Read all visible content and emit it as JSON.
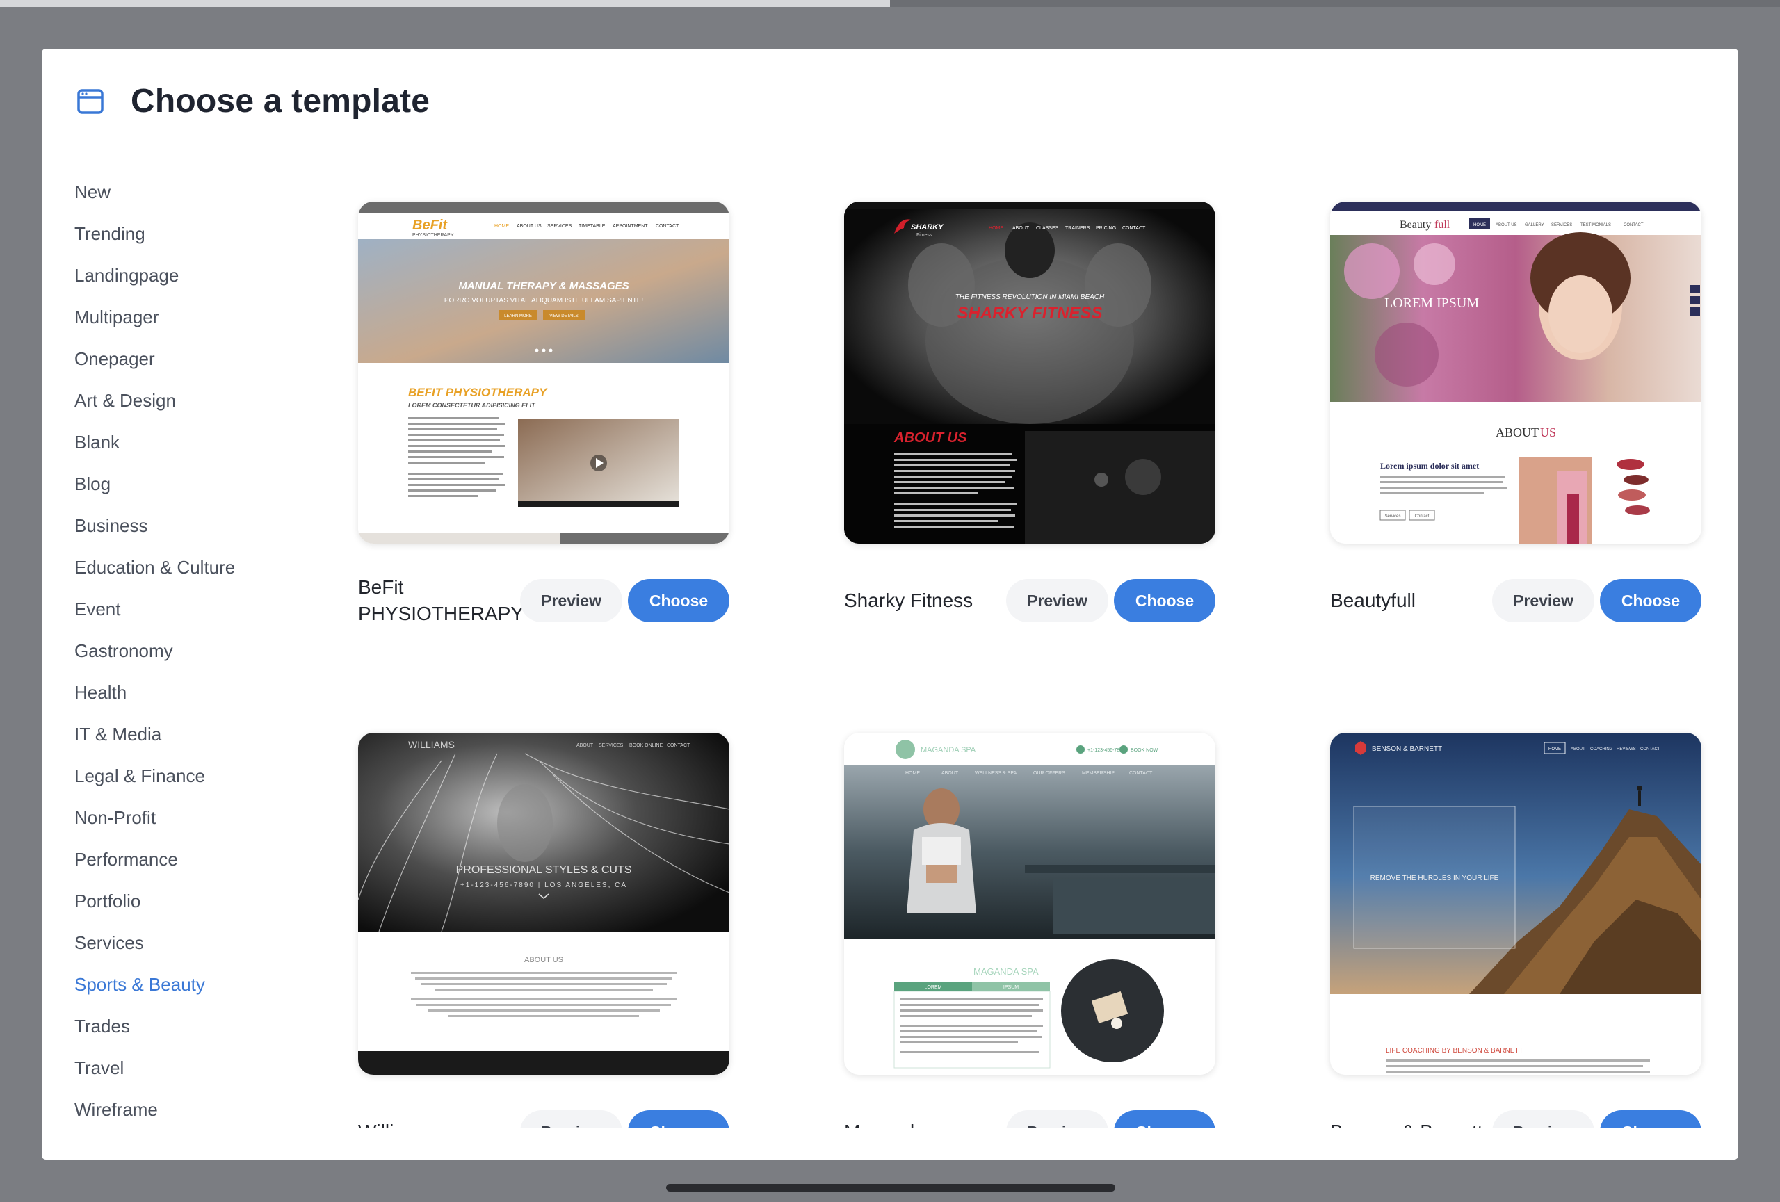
{
  "modal": {
    "title": "Choose a template",
    "title_icon": "browser-window-icon",
    "accent": "#3a78d6"
  },
  "sidebar": {
    "active": "Sports & Beauty",
    "items": [
      {
        "label": "New"
      },
      {
        "label": "Trending"
      },
      {
        "label": "Landingpage"
      },
      {
        "label": "Multipager"
      },
      {
        "label": "Onepager"
      },
      {
        "label": "Art & Design"
      },
      {
        "label": "Blank"
      },
      {
        "label": "Blog"
      },
      {
        "label": "Business"
      },
      {
        "label": "Education & Culture"
      },
      {
        "label": "Event"
      },
      {
        "label": "Gastronomy"
      },
      {
        "label": "Health"
      },
      {
        "label": "IT & Media"
      },
      {
        "label": "Legal & Finance"
      },
      {
        "label": "Non-Profit"
      },
      {
        "label": "Performance"
      },
      {
        "label": "Portfolio"
      },
      {
        "label": "Services"
      },
      {
        "label": "Sports & Beauty"
      },
      {
        "label": "Trades"
      },
      {
        "label": "Travel"
      },
      {
        "label": "Wireframe"
      }
    ]
  },
  "buttons": {
    "preview": "Preview",
    "choose": "Choose"
  },
  "templates": [
    {
      "name": "BeFit PHYSIOTHERAPY",
      "thumb": {
        "logo": "BeFit",
        "logo_sub": "PHYSIOTHERAPY",
        "nav": [
          "HOME",
          "ABOUT US",
          "SERVICES",
          "TIMETABLE",
          "APPOINTMENT",
          "CONTACT"
        ],
        "hero_title": "MANUAL THERAPY & MASSAGES",
        "hero_sub": "PORRO VOLUPTAS VITAE ALIQUAM ISTE ULLAM SAPIENTE!",
        "btn1": "LEARN MORE",
        "btn2": "VIEW DETAILS",
        "section_title": "BEFIT PHYSIOTHERAPY",
        "section_sub": "LOREM CONSECTETUR ADIPISICING ELIT"
      }
    },
    {
      "name": "Sharky Fitness",
      "thumb": {
        "logo": "SHARKY",
        "logo_sub": "Fitness",
        "nav": [
          "HOME",
          "ABOUT",
          "CLASSES",
          "TRAINERS",
          "PRICING",
          "CONTACT"
        ],
        "hero_kicker": "THE FITNESS REVOLUTION IN MIAMI BEACH",
        "hero_title": "SHARKY FITNESS",
        "section_title": "ABOUT US"
      }
    },
    {
      "name": "Beautyfull",
      "thumb": {
        "logo_a": "Beauty",
        "logo_b": "full",
        "nav": [
          "HOME",
          "ABOUT US",
          "GALLERY",
          "SERVICES",
          "TESTIMONIALS",
          "CONTACT"
        ],
        "hero_title": "LOREM IPSUM",
        "section_a": "ABOUT",
        "section_b": "US",
        "subheading": "Lorem ipsum dolor sit amet",
        "tag1": "Services",
        "tag2": "Contact"
      }
    },
    {
      "name": "Williams",
      "thumb": {
        "logo": "WILLIAMS",
        "nav": [
          "ABOUT",
          "SERVICES",
          "BOOK ONLINE",
          "CONTACT"
        ],
        "hero_title": "PROFESSIONAL STYLES & CUTS",
        "hero_sub": "+1-123-456-7890 | LOS ANGELES, CA",
        "section_title": "ABOUT US"
      }
    },
    {
      "name": "Maganda",
      "thumb": {
        "logo": "MAGANDA SPA",
        "phone": "+1-123-456-7890",
        "book": "BOOK NOW",
        "nav": [
          "HOME",
          "ABOUT",
          "WELLNESS & SPA",
          "OUR OFFERS",
          "MEMBERSHIP",
          "CONTACT"
        ],
        "section_title": "MAGANDA SPA",
        "tab1": "LOREM",
        "tab2": "IPSUM"
      }
    },
    {
      "name": "Benson & Barnett",
      "thumb": {
        "logo": "BENSON & BARNETT",
        "nav": [
          "HOME",
          "ABOUT",
          "COACHING",
          "REVIEWS",
          "CONTACT"
        ],
        "hero_title": "REMOVE THE HURDLES IN YOUR LIFE",
        "section_title": "LIFE COACHING BY BENSON & BARNETT"
      }
    }
  ]
}
